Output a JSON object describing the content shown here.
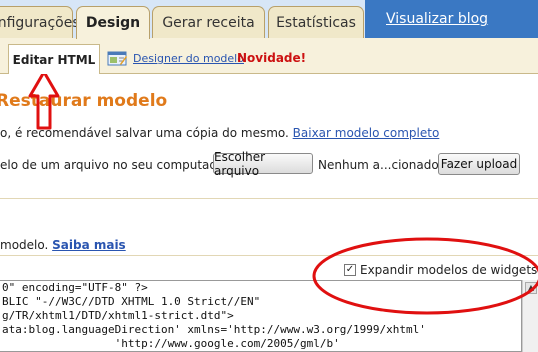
{
  "tabs": [
    {
      "label": "Configurações",
      "active": false
    },
    {
      "label": "Design",
      "active": true
    },
    {
      "label": "Gerar receita",
      "active": false
    },
    {
      "label": "Estatísticas",
      "active": false
    }
  ],
  "view_blog": "Visualizar blog",
  "subtabs": {
    "edit_html": "Editar HTML",
    "designer": "Designer do modelo",
    "new_badge": "Novidade!"
  },
  "restore": {
    "title": "Restaurar modelo",
    "desc_text": "o, é recomendável salvar uma cópia do mesmo. ",
    "download_link": "Baixar modelo completo",
    "upload_label": "elo de um arquivo no seu computador:",
    "choose_button": "Escolher arquivo",
    "no_file": "Nenhum a...cionado",
    "upload_button": "Fazer upload"
  },
  "edit": {
    "model_text": "modelo. ",
    "learn_more": "Saiba mais",
    "expand_widgets_label": "Expandir modelos de widgets",
    "expand_widgets_checked": true,
    "checkbox_glyph": "✓"
  },
  "code_lines": [
    "0\" encoding=\"UTF-8\" ?>",
    "BLIC \"-//W3C//DTD XHTML 1.0 Strict//EN\"",
    "g/TR/xhtml1/DTD/xhtml1-strict.dtd\">",
    "ata:blog.languageDirection' xmlns='http://www.w3.org/1999/xhtml'",
    "                 'http://www.google.com/2005/gml/b'"
  ],
  "colors": {
    "tab_bg": "#f0e8c9",
    "toolbar_bg": "#f7f1dc",
    "blue_bar": "#3a78c3",
    "title_orange": "#e07a1b",
    "link_blue": "#2a55b0",
    "annotation_red": "#e01010"
  },
  "icons": {
    "designer": "designer-icon",
    "scroll_up": "scroll-up-arrow"
  }
}
